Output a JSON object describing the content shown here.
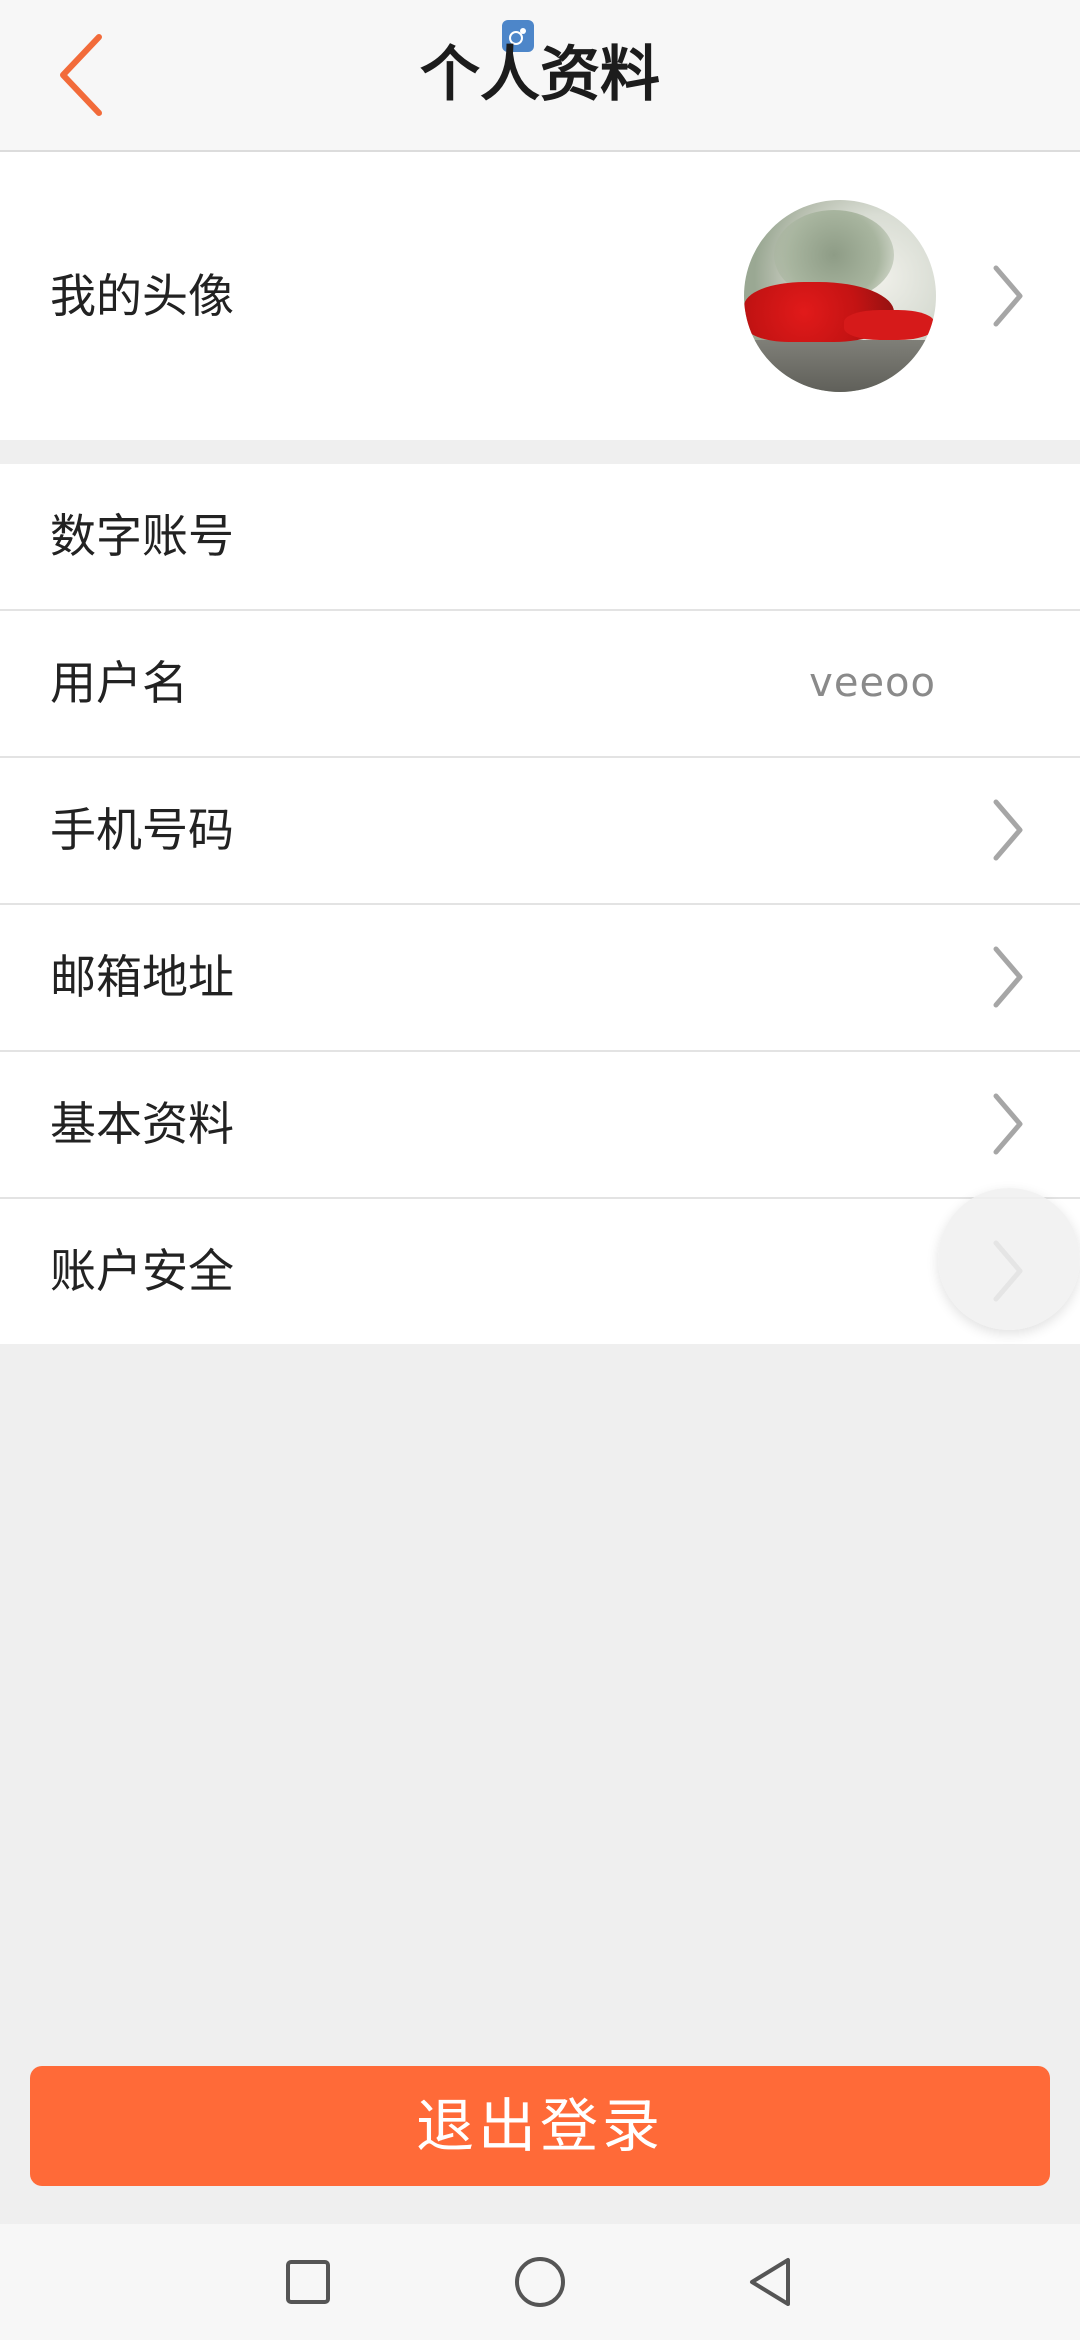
{
  "header": {
    "title": "个人资料",
    "back_icon": "chevron-left-icon",
    "accent_color": "#f26b3a"
  },
  "avatar_row": {
    "label": "我的头像"
  },
  "list": {
    "items": [
      {
        "label": "数字账号",
        "value": "",
        "has_chevron": false
      },
      {
        "label": "用户名",
        "value": "veeoo",
        "has_chevron": false
      },
      {
        "label": "手机号码",
        "value": "",
        "has_chevron": true
      },
      {
        "label": "邮箱地址",
        "value": "",
        "has_chevron": true
      },
      {
        "label": "基本资料",
        "value": "",
        "has_chevron": true
      },
      {
        "label": "账户安全",
        "value": "",
        "has_chevron": true
      }
    ]
  },
  "logout": {
    "label": "退出登录",
    "color": "#ff6a38"
  },
  "nav": {
    "recent_icon": "square-icon",
    "home_icon": "circle-icon",
    "back_icon": "triangle-back-icon"
  }
}
